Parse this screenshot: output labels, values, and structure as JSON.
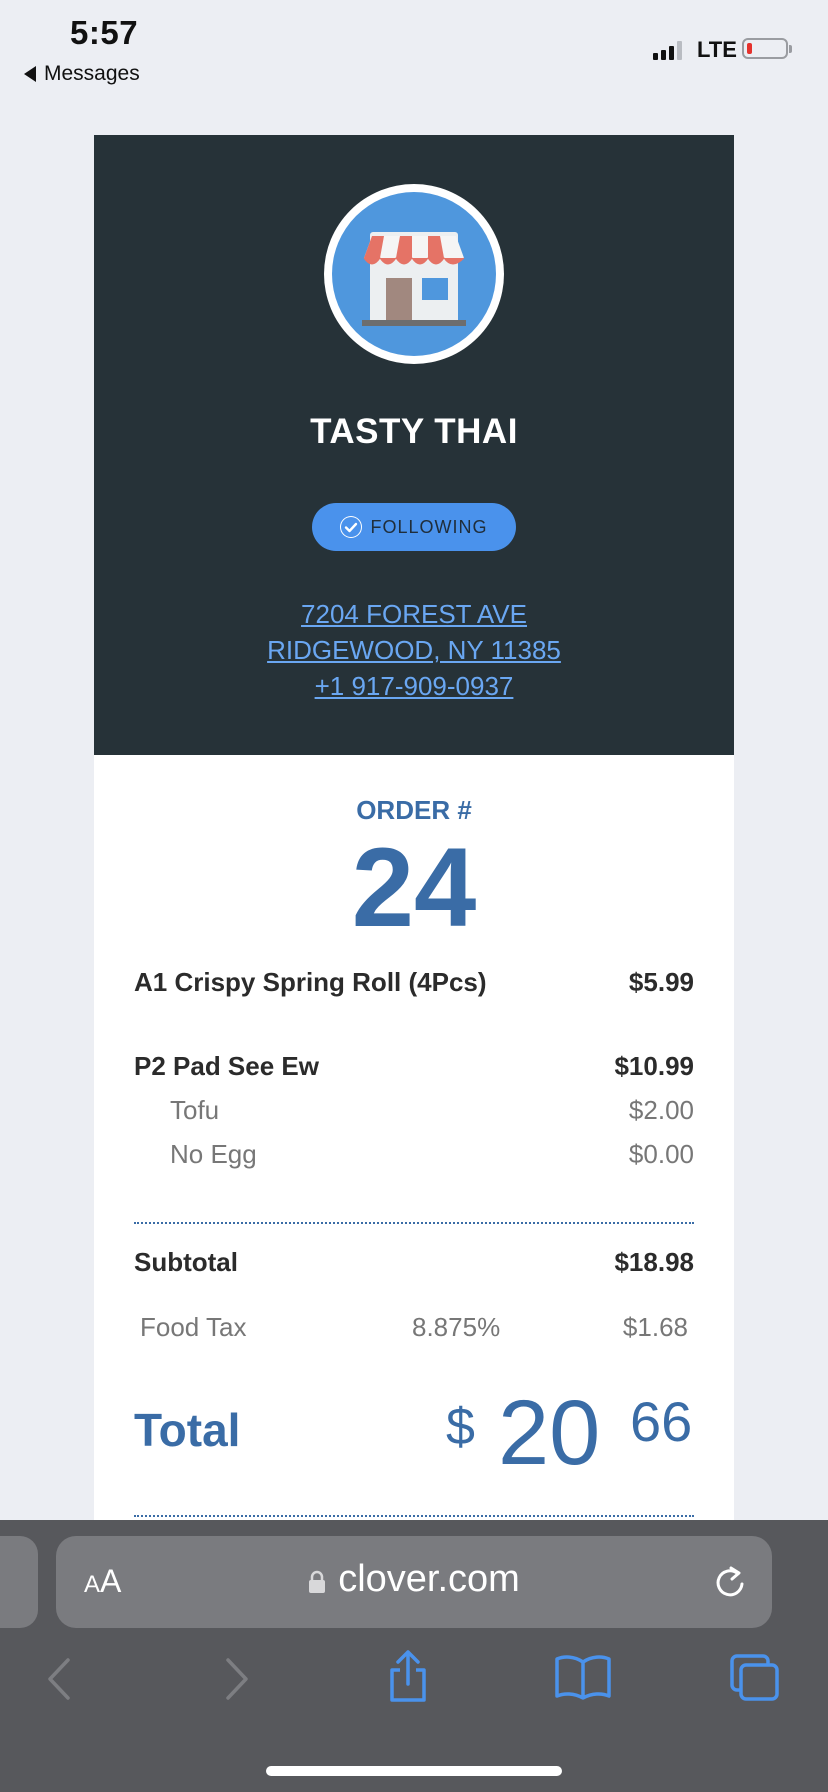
{
  "status_bar": {
    "time": "5:57",
    "back_label": "Messages",
    "network": "LTE",
    "battery_color": "#E5322D"
  },
  "store": {
    "logo_icon": "storefront-icon",
    "name": "TASTY THAI",
    "follow_label": "FOLLOWING",
    "address_line1": "7204 FOREST AVE",
    "address_line2": "RIDGEWOOD, NY 11385",
    "phone": "+1 917-909-0937"
  },
  "order": {
    "label": "ORDER #",
    "number": "24",
    "items": [
      {
        "name": "A1 Crispy Spring Roll (4Pcs)",
        "price": "$5.99",
        "modifiers": []
      },
      {
        "name": "P2 Pad See Ew",
        "price": "$10.99",
        "modifiers": [
          {
            "name": "Tofu",
            "price": "$2.00"
          },
          {
            "name": "No Egg",
            "price": "$0.00"
          }
        ]
      }
    ],
    "subtotal_label": "Subtotal",
    "subtotal": "$18.98",
    "tax": {
      "label": "Food Tax",
      "rate": "8.875%",
      "amount": "$1.68"
    },
    "total_label": "Total",
    "total_currency": "$",
    "total_whole": "20",
    "total_cents": "66"
  },
  "browser": {
    "text_size_label_small": "A",
    "text_size_label_large": "A",
    "url": "clover.com",
    "icons": [
      "back-icon",
      "forward-icon",
      "share-icon",
      "bookmarks-icon",
      "tabs-icon",
      "reload-icon",
      "lock-icon"
    ]
  },
  "colors": {
    "header_bg": "#263238",
    "accent": "#3A6CA6",
    "link": "#6AA7F2",
    "follow_button": "#4A92EC"
  }
}
